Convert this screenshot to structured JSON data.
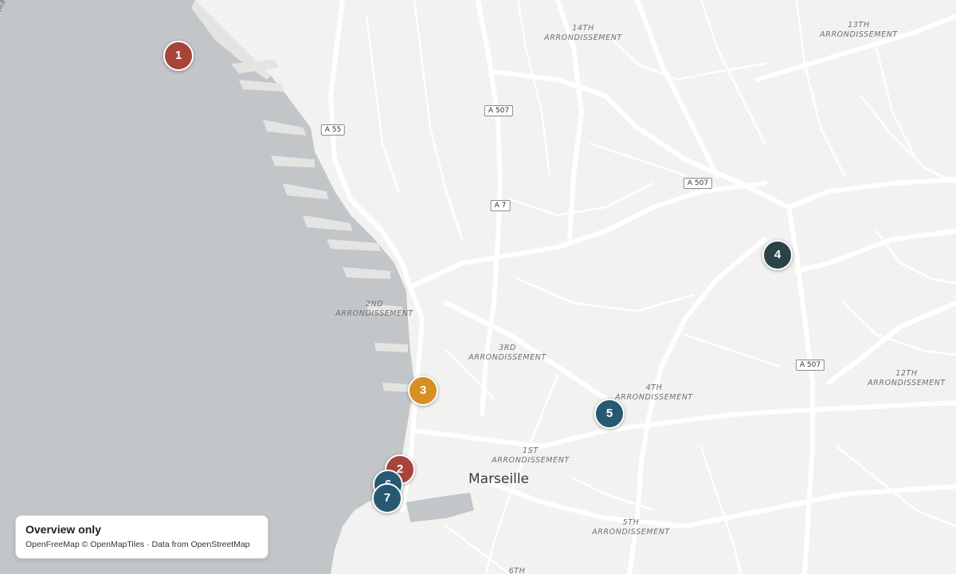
{
  "map": {
    "colors": {
      "sea": "#c3c6c8",
      "land": "#f2f2f1",
      "road": "#ffffff",
      "road_casing": "#e2e2e2"
    },
    "city_label": "Marseille",
    "coast_partial_label": "Marse",
    "district_labels": [
      {
        "line1": "14TH",
        "line2": "ARRONDISSEMENT"
      },
      {
        "line1": "13TH",
        "line2": "ARRONDISSEMENT"
      },
      {
        "line1": "2ND",
        "line2": "ARRONDISSEMENT"
      },
      {
        "line1": "3RD",
        "line2": "ARRONDISSEMENT"
      },
      {
        "line1": "4TH",
        "line2": "ARRONDISSEMENT"
      },
      {
        "line1": "12TH",
        "line2": "ARRONDISSEMENT"
      },
      {
        "line1": "1ST",
        "line2": "ARRONDISSEMENT"
      },
      {
        "line1": "5TH",
        "line2": "ARRONDISSEMENT"
      },
      {
        "line1": "6TH",
        "line2": ""
      }
    ],
    "road_shields": [
      "A 507",
      "A 55",
      "A 7",
      "A 507",
      "A 507"
    ],
    "markers": [
      {
        "label": "1",
        "color": "#a8443a"
      },
      {
        "label": "2",
        "color": "#a8443a"
      },
      {
        "label": "3",
        "color": "#d68f22"
      },
      {
        "label": "4",
        "color": "#2a4347"
      },
      {
        "label": "5",
        "color": "#275a72"
      },
      {
        "label": "6",
        "color": "#275a72"
      },
      {
        "label": "7",
        "color": "#275a72"
      }
    ]
  },
  "attribution": {
    "title": "Overview only",
    "text": "OpenFreeMap © OpenMapTiles · Data from OpenStreetMap"
  }
}
